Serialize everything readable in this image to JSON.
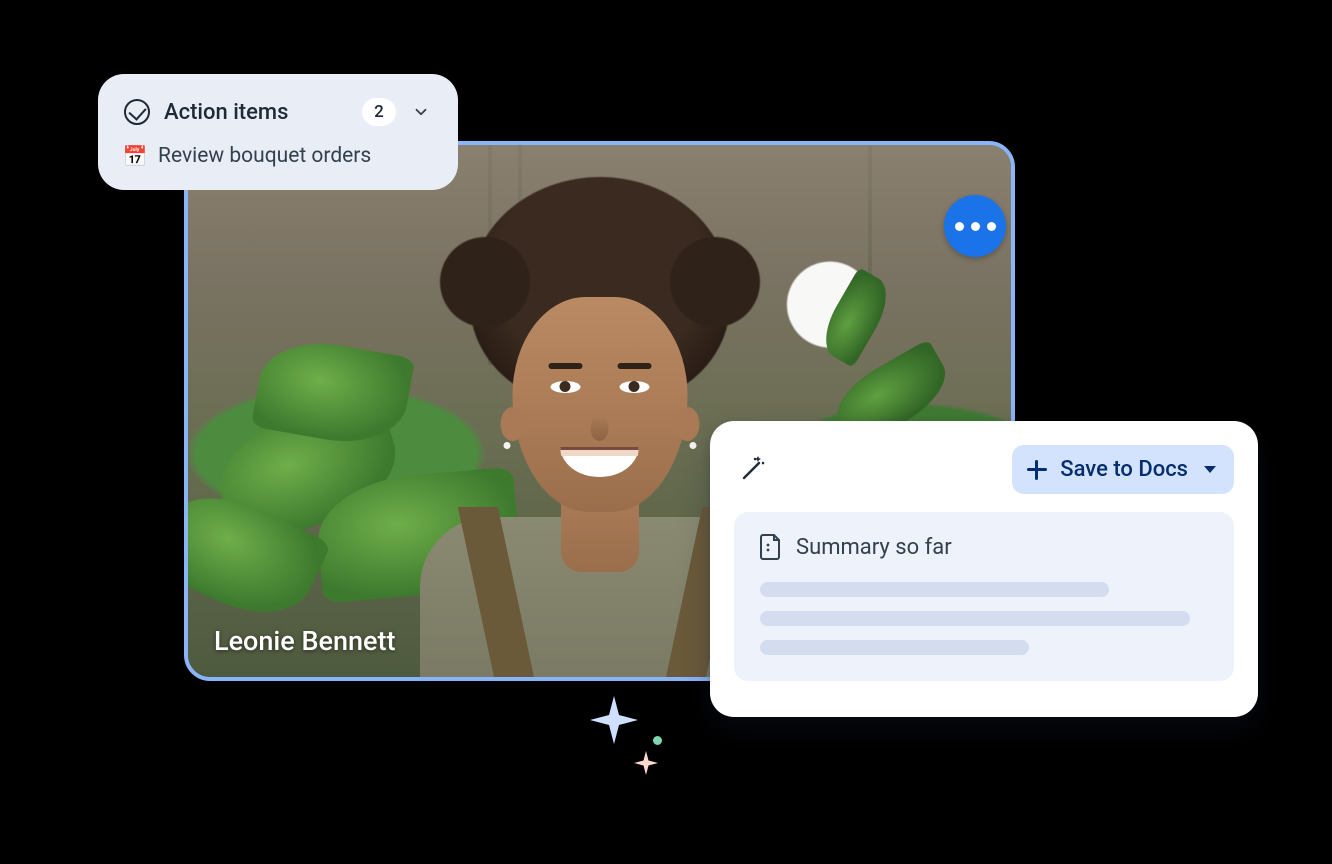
{
  "participant": {
    "name": "Leonie Bennett"
  },
  "action_items": {
    "title": "Action items",
    "count": "2",
    "items": [
      {
        "icon": "calendar-icon",
        "text": "Review bouquet orders"
      }
    ]
  },
  "summary": {
    "save_button_label": "Save to Docs",
    "title": "Summary so far"
  }
}
